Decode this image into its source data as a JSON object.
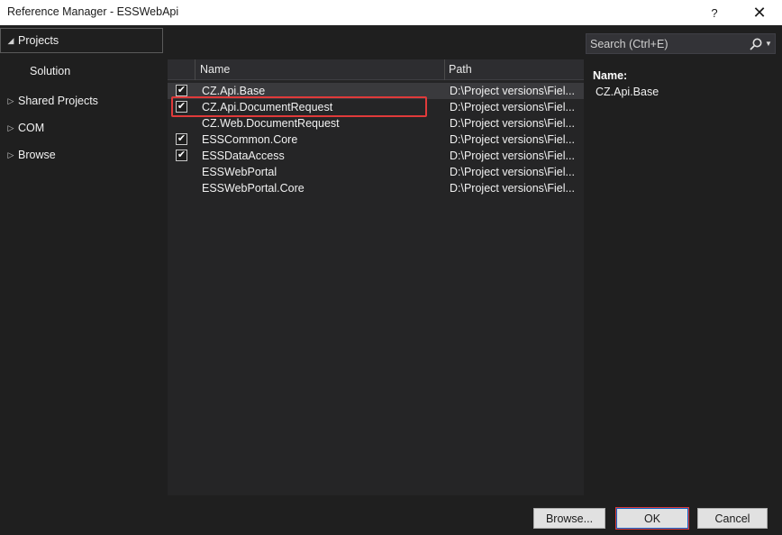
{
  "window": {
    "title": "Reference Manager - ESSWebApi",
    "help_glyph": "?",
    "close_glyph": "✕"
  },
  "nav": {
    "items": [
      {
        "label": "Projects",
        "arrow": "◢"
      },
      {
        "label": "Solution"
      },
      {
        "label": "Shared Projects",
        "arrow": "▷"
      },
      {
        "label": "COM",
        "arrow": "▷"
      },
      {
        "label": "Browse",
        "arrow": "▷"
      }
    ]
  },
  "search": {
    "placeholder": "Search (Ctrl+E)",
    "dropdown_glyph": "▼"
  },
  "grid": {
    "columns": [
      "Name",
      "Path"
    ],
    "rows": [
      {
        "name": "CZ.Api.Base",
        "path": "D:\\Project versions\\Fiel...",
        "checked": true,
        "selected": true
      },
      {
        "name": "CZ.Api.DocumentRequest",
        "path": "D:\\Project versions\\Fiel...",
        "checked": true,
        "selected": false,
        "highlighted": true
      },
      {
        "name": "CZ.Web.DocumentRequest",
        "path": "D:\\Project versions\\Fiel...",
        "checked": false,
        "selected": false
      },
      {
        "name": "ESSCommon.Core",
        "path": "D:\\Project versions\\Fiel...",
        "checked": true,
        "selected": false
      },
      {
        "name": "ESSDataAccess",
        "path": "D:\\Project versions\\Fiel...",
        "checked": true,
        "selected": false
      },
      {
        "name": "ESSWebPortal",
        "path": "D:\\Project versions\\Fiel...",
        "checked": false,
        "selected": false
      },
      {
        "name": "ESSWebPortal.Core",
        "path": "D:\\Project versions\\Fiel...",
        "checked": false,
        "selected": false
      }
    ],
    "check_glyph": "✔"
  },
  "details": {
    "name_label": "Name:",
    "name_value": "CZ.Api.Base"
  },
  "buttons": {
    "browse": "Browse...",
    "ok": "OK",
    "cancel": "Cancel"
  },
  "colors": {
    "highlight_border": "#e03a3a",
    "background": "#1f1f1f",
    "grid_background": "#252526"
  }
}
